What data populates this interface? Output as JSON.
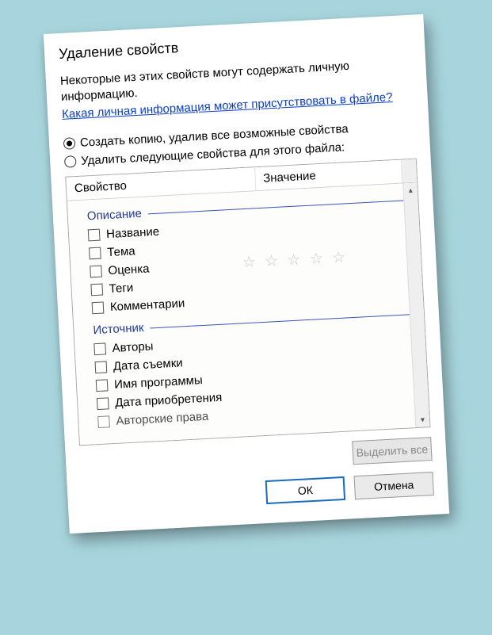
{
  "title": "Удаление свойств",
  "intro": "Некоторые из этих свойств могут содержать личную информацию.",
  "link": "Какая личная информация может присутствовать в файле?",
  "radio1": "Создать копию, удалив все возможные свойства",
  "radio2": "Удалить следующие свойства для этого файла:",
  "columns": {
    "property": "Свойство",
    "value": "Значение"
  },
  "groups": {
    "description": {
      "label": "Описание",
      "items": [
        "Название",
        "Тема",
        "Оценка",
        "Теги",
        "Комментарии"
      ]
    },
    "source": {
      "label": "Источник",
      "items": [
        "Авторы",
        "Дата съемки",
        "Имя программы",
        "Дата приобретения",
        "Авторские права"
      ]
    }
  },
  "buttons": {
    "selectAll": "Выделить все",
    "ok": "ОК",
    "cancel": "Отмена"
  },
  "rating_stars": "☆ ☆ ☆ ☆ ☆"
}
